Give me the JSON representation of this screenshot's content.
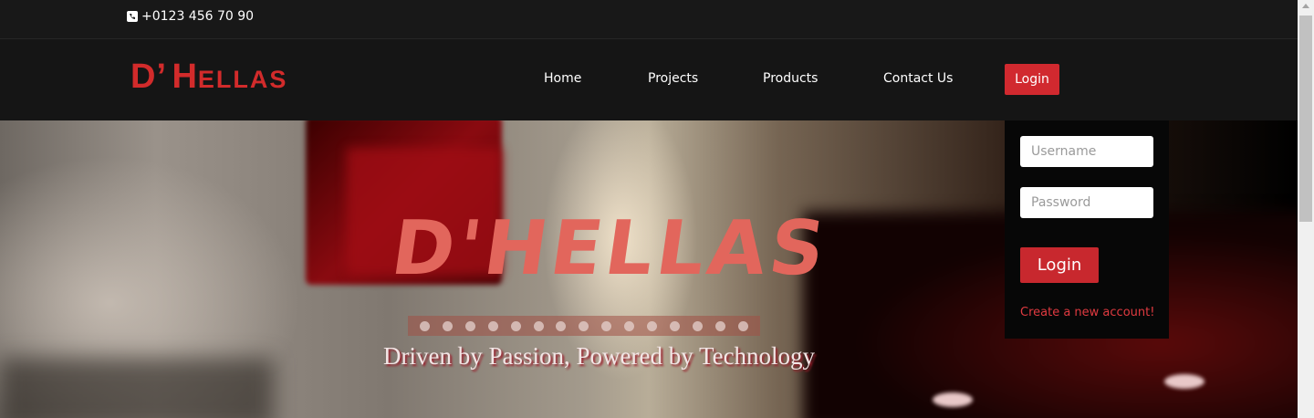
{
  "topbar": {
    "phone": "+0123 456 70 90",
    "phone_icon": "phone-icon"
  },
  "logo": {
    "initial": "D",
    "apostrophe": "’",
    "name_first": "H",
    "name_rest": "ELLAS"
  },
  "nav": {
    "home": "Home",
    "projects": "Projects",
    "products": "Products",
    "contact": "Contact Us",
    "login": "Login"
  },
  "login_form": {
    "username_placeholder": "Username",
    "password_placeholder": "Password",
    "submit": "Login",
    "create_account": "Create a new account!"
  },
  "hero": {
    "title": "D'HELLAS",
    "tagline": "Driven by Passion, Powered by Technology"
  },
  "colors": {
    "brand": "#d1292f",
    "link": "#e03a40",
    "dark": "#151515"
  }
}
